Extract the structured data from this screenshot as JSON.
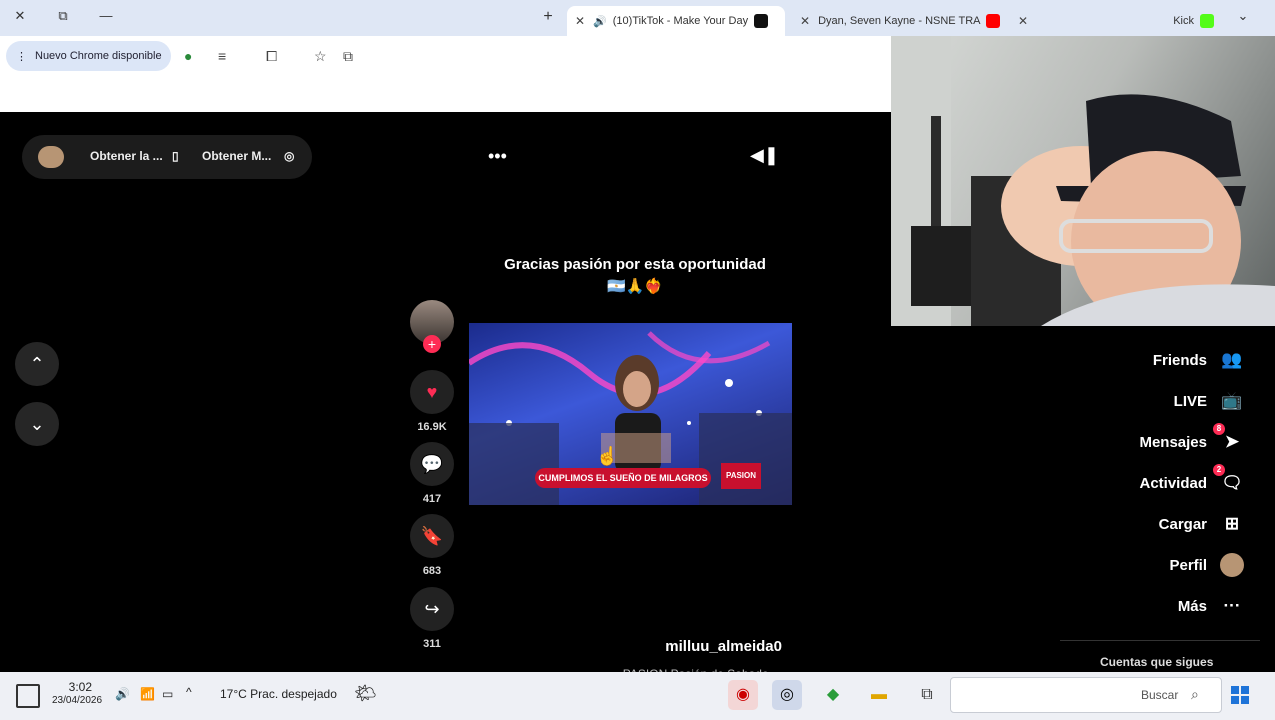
{
  "browser": {
    "tabs": [
      {
        "label": "Kick",
        "favicon_color": "#53fc18"
      },
      {
        "label": "Dyan, Seven Kayne - NSNE TRA",
        "favicon_color": "#ff0000"
      },
      {
        "label": "(10)TikTok - Make Your Day",
        "favicon_color": "#111111",
        "audio_icon": "speaker-icon"
      }
    ],
    "new_tab": "+",
    "update_button": "Nuevo Chrome disponible"
  },
  "tiktok": {
    "top_controls": {
      "item1": "Obtener M...",
      "item2": "Obtener la ..."
    },
    "caption_line1": "Gracias pasión por esta oportunidad",
    "caption_line2": "🇦🇷🙏❤️‍🔥",
    "video": {
      "banner": "CUMPLIMOS EL SUEÑO DE MILAGROS",
      "tag": "PASION"
    },
    "actions": {
      "likes": "16.9K",
      "comments": "417",
      "saves": "683",
      "shares": "311"
    },
    "username": "milluu_almeida0",
    "description": "PASION Pasión de Sabado ...",
    "sidebar": {
      "friends": "Friends",
      "live": "LIVE",
      "messages": "Mensajes",
      "messages_badge": "8",
      "activity": "Actividad",
      "activity_badge": "2",
      "upload": "Cargar",
      "profile": "Perfil",
      "more": "Más",
      "following_accounts": "Cuentas que sigues"
    },
    "accent": "#fe2c55"
  },
  "taskbar": {
    "search_placeholder": "Buscar",
    "weather": "17°C  Prac. despejado",
    "time": "3:02",
    "date": "23/04/2026"
  }
}
